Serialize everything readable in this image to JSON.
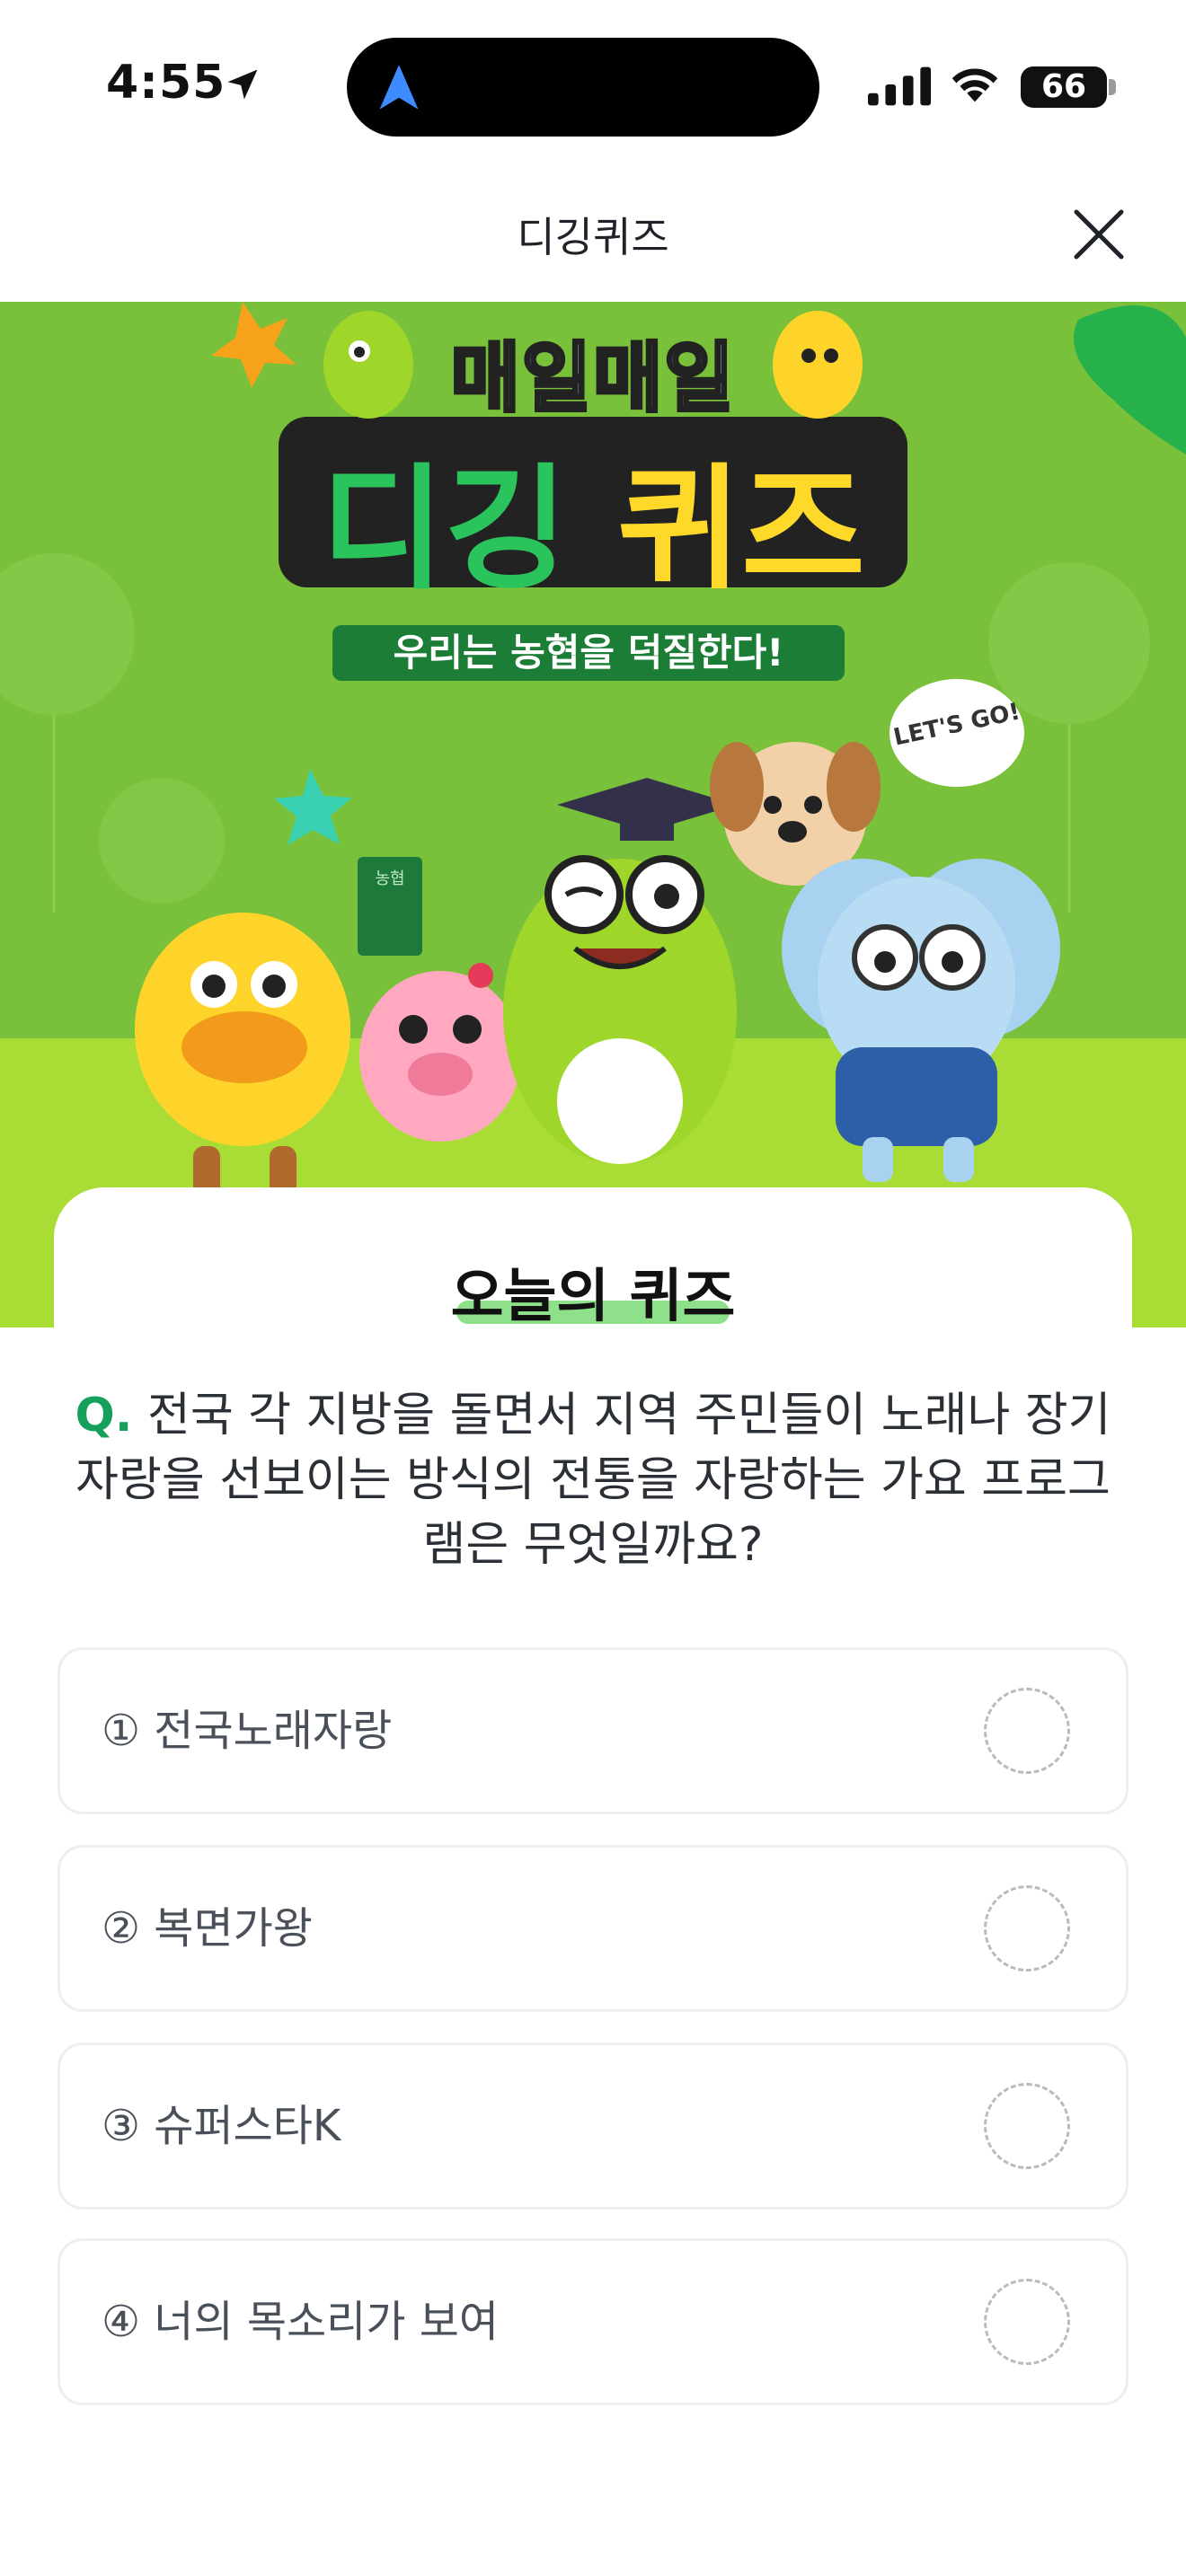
{
  "status_bar": {
    "time": "4:55",
    "battery": "66"
  },
  "nav": {
    "title": "디깅퀴즈"
  },
  "banner": {
    "top_text": "매일매일",
    "main_text_1": "디깅",
    "main_text_2": "퀴즈",
    "slogan": "우리는 농협을 덕질한다!",
    "lets_go": "LET'S GO!",
    "book_label": "농협",
    "colors": {
      "green": "#79c13a",
      "lime": "#a9dc34"
    }
  },
  "quiz": {
    "section_title": "오늘의 퀴즈",
    "question_prefix": "Q.",
    "question": "전국 각 지방을 돌면서 지역 주민들이 노래나 장기자랑을 선보이는 방식의 전통을 자랑하는 가요 프로그램은 무엇일까요?",
    "options": [
      {
        "label": "① 전국노래자랑"
      },
      {
        "label": "② 복면가왕"
      },
      {
        "label": "③ 슈퍼스타K"
      },
      {
        "label": "④ 너의 목소리가 보여"
      }
    ]
  }
}
